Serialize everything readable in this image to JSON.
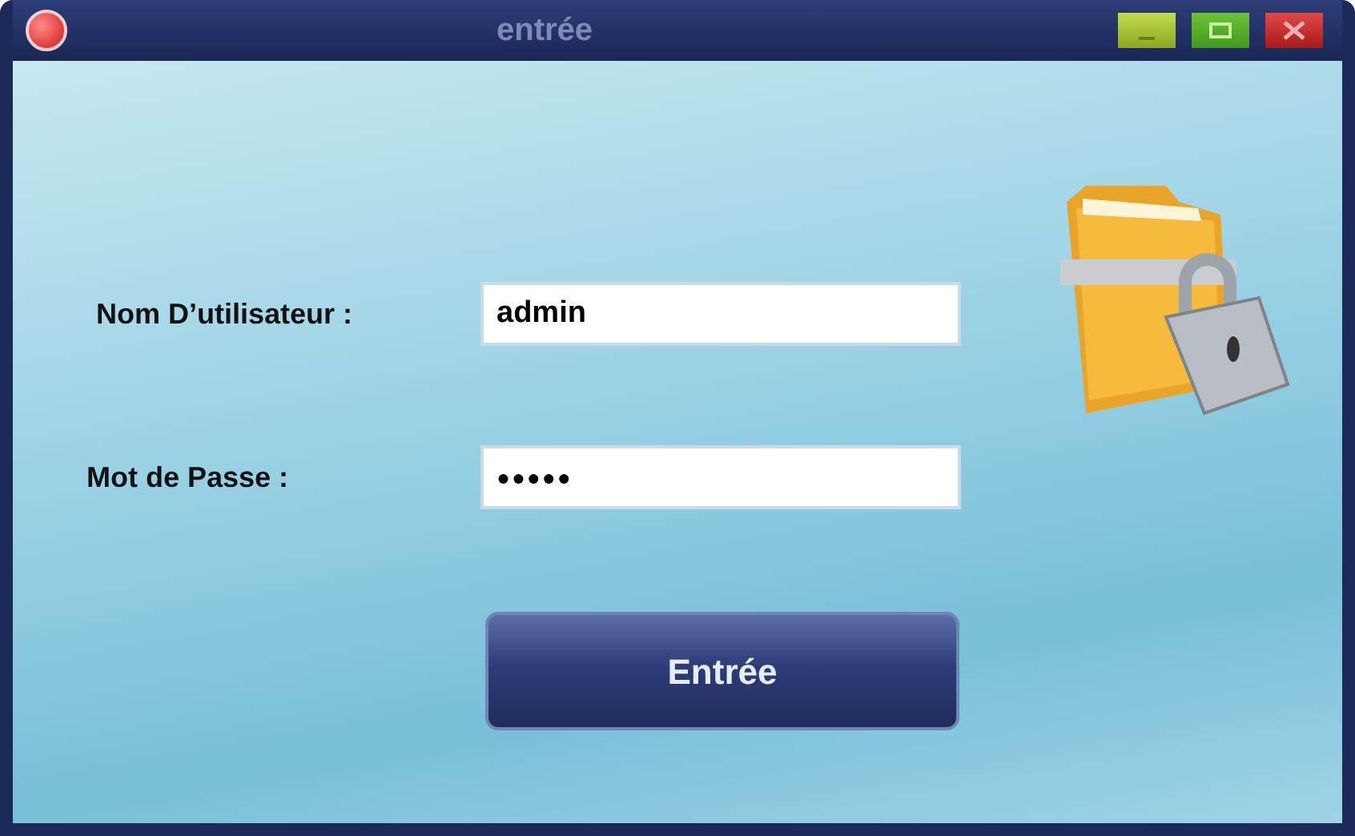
{
  "window": {
    "title": "entrée"
  },
  "fields": [
    {
      "label": "Nom D’utilisateur :",
      "value": "admin"
    },
    {
      "label": "Mot de Passe :",
      "value": "●●●●●"
    }
  ],
  "submit": {
    "label": "Entrée"
  }
}
